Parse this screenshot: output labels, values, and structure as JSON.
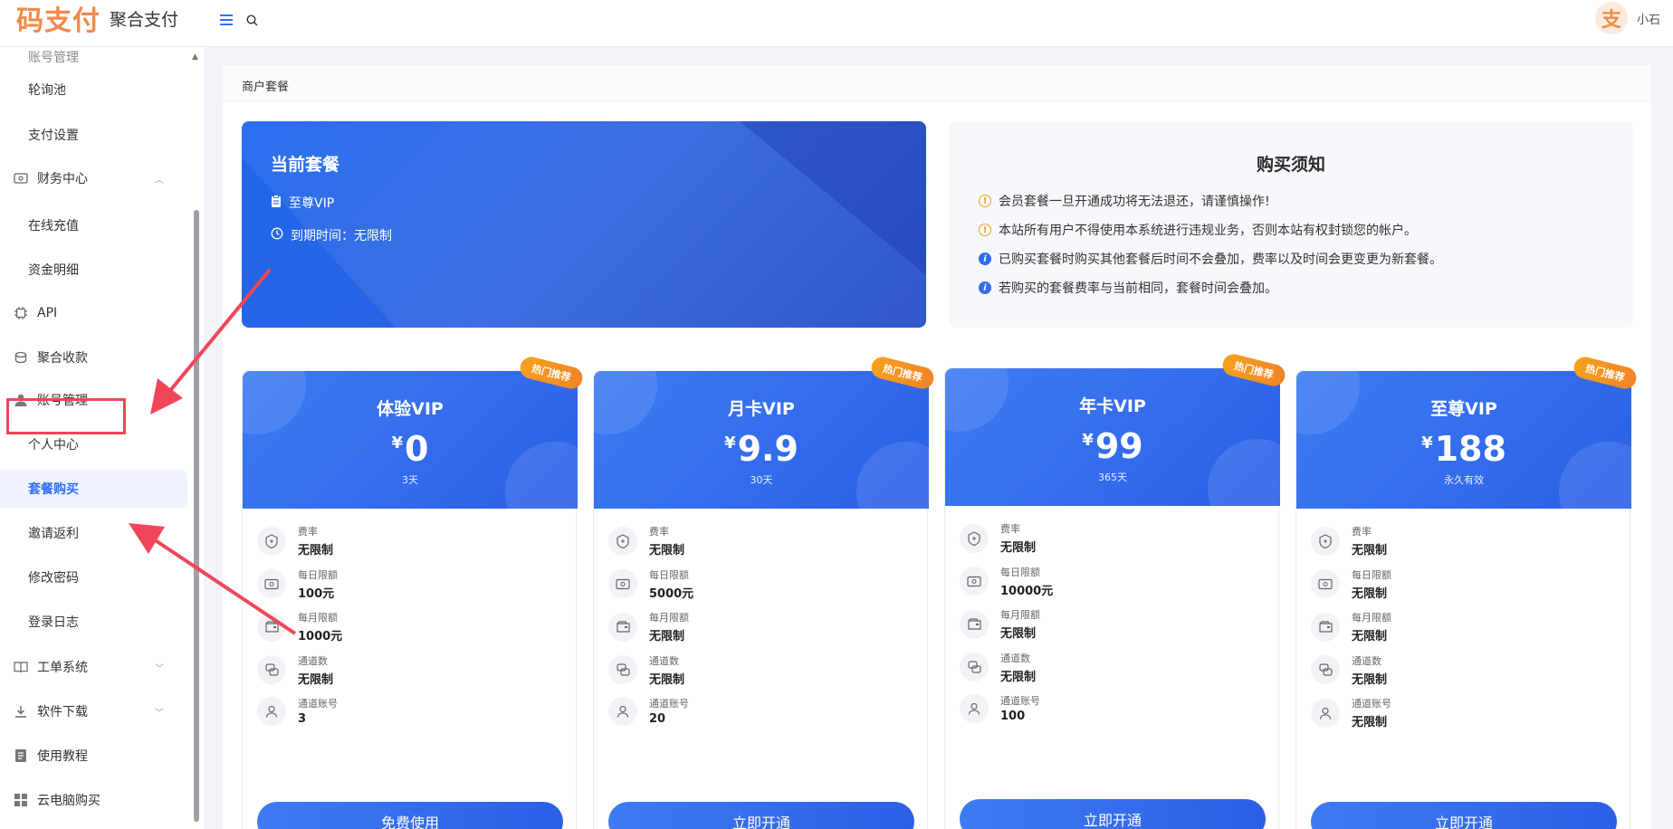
{
  "brand": {
    "mark": "码支付",
    "name": "聚合支付",
    "accent": "#f08a4b"
  },
  "header": {
    "menu_icon": "menu-icon",
    "search_icon": "search-icon"
  },
  "user": {
    "avatar_char": "支",
    "name": "小石"
  },
  "sidebar": {
    "items": [
      {
        "label": "账号管理",
        "kind": "sub"
      },
      {
        "label": "轮询池",
        "kind": "sub"
      },
      {
        "label": "支付设置",
        "kind": "sub"
      },
      {
        "label": "财务中心",
        "kind": "top",
        "icon": "finance-icon"
      },
      {
        "label": "在线充值",
        "kind": "sub"
      },
      {
        "label": "资金明细",
        "kind": "sub"
      },
      {
        "label": "API",
        "kind": "top",
        "icon": "chip-icon"
      },
      {
        "label": "聚合收款",
        "kind": "top",
        "icon": "collect-icon"
      },
      {
        "label": "账号管理",
        "kind": "top",
        "icon": "user-icon"
      },
      {
        "label": "个人中心",
        "kind": "sub"
      },
      {
        "label": "套餐购买",
        "kind": "sub",
        "active": true
      },
      {
        "label": "邀请返利",
        "kind": "sub"
      },
      {
        "label": "修改密码",
        "kind": "sub"
      },
      {
        "label": "登录日志",
        "kind": "sub"
      },
      {
        "label": "工单系统",
        "kind": "top",
        "icon": "book-icon"
      },
      {
        "label": "软件下载",
        "kind": "top",
        "icon": "download-icon"
      },
      {
        "label": "使用教程",
        "kind": "top",
        "icon": "doc-icon"
      },
      {
        "label": "云电脑购买",
        "kind": "top",
        "icon": "grid-icon"
      }
    ]
  },
  "panel": {
    "title": "商户套餐"
  },
  "current_plan": {
    "title": "当前套餐",
    "plan": "至尊VIP",
    "expire_label": "到期时间：无限制"
  },
  "notice": {
    "title": "购买须知",
    "items": [
      {
        "type": "warn",
        "text": "会员套餐一旦开通成功将无法退还，请谨慎操作!"
      },
      {
        "type": "warn",
        "text": "本站所有用户不得使用本系统进行违规业务，否则本站有权封锁您的帐户。"
      },
      {
        "type": "info",
        "text": "已购买套餐时购买其他套餐后时间不会叠加，费率以及时间会更变更为新套餐。"
      },
      {
        "type": "info",
        "text": "若购买的套餐费率与当前相同，套餐时间会叠加。"
      }
    ]
  },
  "plans": [
    {
      "name": "体验VIP",
      "currency": "¥",
      "price": "0",
      "duration": "3天",
      "badge": "热门推荐",
      "features": [
        {
          "label": "费率",
          "value": "无限制"
        },
        {
          "label": "每日限额",
          "value": "100元"
        },
        {
          "label": "每月限额",
          "value": "1000元"
        },
        {
          "label": "通道数",
          "value": "无限制"
        },
        {
          "label": "通道账号",
          "value": "3"
        }
      ],
      "button": "免费使用"
    },
    {
      "name": "月卡VIP",
      "currency": "¥",
      "price": "9.9",
      "duration": "30天",
      "badge": "热门推荐",
      "features": [
        {
          "label": "费率",
          "value": "无限制"
        },
        {
          "label": "每日限额",
          "value": "5000元"
        },
        {
          "label": "每月限额",
          "value": "无限制"
        },
        {
          "label": "通道数",
          "value": "无限制"
        },
        {
          "label": "通道账号",
          "value": "20"
        }
      ],
      "button": "立即开通"
    },
    {
      "name": "年卡VIP",
      "currency": "¥",
      "price": "99",
      "duration": "365天",
      "badge": "热门推荐",
      "features": [
        {
          "label": "费率",
          "value": "无限制"
        },
        {
          "label": "每日限额",
          "value": "10000元"
        },
        {
          "label": "每月限额",
          "value": "无限制"
        },
        {
          "label": "通道数",
          "value": "无限制"
        },
        {
          "label": "通道账号",
          "value": "100"
        }
      ],
      "button": "立即开通"
    },
    {
      "name": "至尊VIP",
      "currency": "¥",
      "price": "188",
      "duration": "永久有效",
      "badge": "热门推荐",
      "features": [
        {
          "label": "费率",
          "value": "无限制"
        },
        {
          "label": "每日限额",
          "value": "无限制"
        },
        {
          "label": "每月限额",
          "value": "无限制"
        },
        {
          "label": "通道数",
          "value": "无限制"
        },
        {
          "label": "通道账号",
          "value": "无限制"
        }
      ],
      "button": "立即开通"
    }
  ],
  "colors": {
    "primary": "#2f6df6",
    "annotation": "#f04658",
    "warn": "#f0a020"
  }
}
